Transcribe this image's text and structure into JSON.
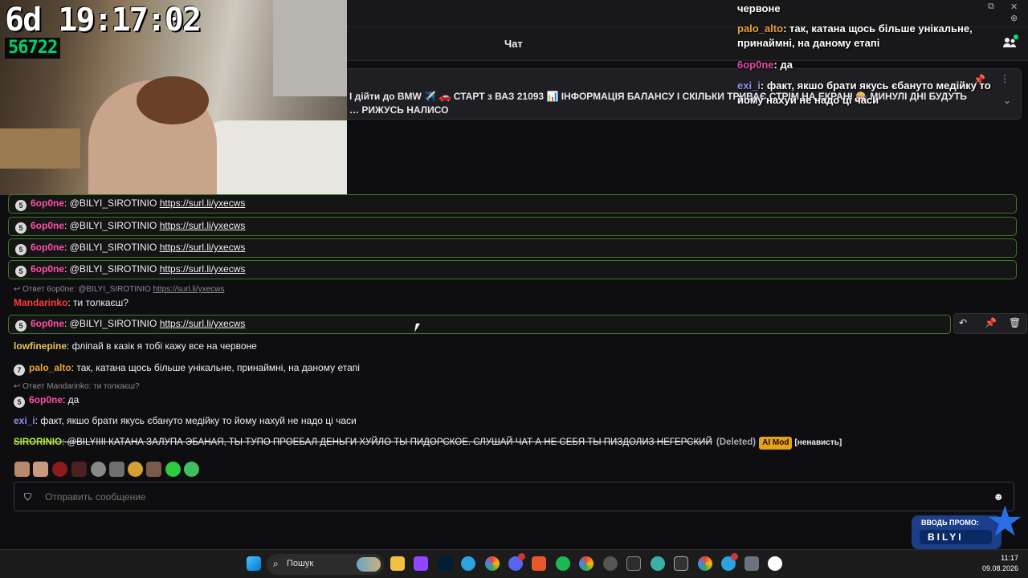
{
  "header": {
    "chat_title": "Чат"
  },
  "pinned": {
    "text": "І дійти до BMW ✈️ 🚗 СТАРТ з ВАЗ 21093 📊 ІНФОРМАЦІЯ БАЛАНСУ І СКІЛЬКИ ТРИВАЄ СТРІМ НА ЕКРАНІ 🎰 МИНУЛІ ДНІ БУДУТЬ … РИЖУСЬ НАЛИСО"
  },
  "stream": {
    "timer": "6d 19:17:02",
    "counter": "56722"
  },
  "overlay_chat": [
    {
      "user": "",
      "text": "червоне",
      "color": "#ffffff"
    },
    {
      "user": "palo_alto",
      "text": ": так, катана щось більше унікальне, принаймні, на даному етапі",
      "color": "#e8a23a"
    },
    {
      "user": "6op0ne",
      "text": ": да",
      "color": "#e54aa9"
    },
    {
      "user": "exi_i",
      "text": ": факт, якшо брати якусь єбануто медійку то йому нахуй не надо ці часи",
      "color": "#8f8ff0"
    }
  ],
  "messages": {
    "m1": {
      "badge": "5",
      "user": "6op0ne",
      "mention": ": @BILYI_SIROTINIO",
      "link": "https://surl.li/yxecws",
      "color": "#ff4fa7"
    },
    "m2": {
      "badge": "5",
      "user": "6op0ne",
      "mention": ": @BILYI_SIROTINIO",
      "link": "https://surl.li/yxecws",
      "color": "#ff4fa7"
    },
    "m3": {
      "badge": "5",
      "user": "6op0ne",
      "mention": ": @BILYI_SIROTINIO",
      "link": "https://surl.li/yxecws",
      "color": "#ff4fa7"
    },
    "m4": {
      "badge": "5",
      "user": "6op0ne",
      "mention": ": @BILYI_SIROTINIO",
      "link": "https://surl.li/yxecws",
      "color": "#ff4fa7"
    },
    "reply1": {
      "prefix": "↩ Ответ 6op0ne: @BILYI_SIROTINIO",
      "link": "https://surl.li/yxecws"
    },
    "m5": {
      "user": "Mandarinko",
      "text": ": ти толкаєш?",
      "color": "#ff3b3b"
    },
    "m6": {
      "badge": "5",
      "user": "6op0ne",
      "mention": ": @BILYI_SIROTINIO",
      "link": "https://surl.li/yxecws",
      "color": "#ff4fa7"
    },
    "m7": {
      "user": "lowfinepine",
      "text": ": фліпай в казік я тобі кажу все на червоне",
      "color": "#e6c45a"
    },
    "m8": {
      "badge": "7",
      "user": "palo_alto",
      "text": ": так, катана щось більше унікальне, принаймні, на даному етапі",
      "color": "#e8a23a"
    },
    "reply2": {
      "prefix": "↩ Ответ Mandarinko: ти толкаєш?"
    },
    "m9": {
      "badge": "5",
      "user": "6op0ne",
      "text": ": да",
      "color": "#ff4fa7"
    },
    "m10": {
      "user": "exi_i",
      "text": ": факт, якшо брати якусь єбануто медійку то йому нахуй не надо ці часи",
      "color": "#8f8ff0"
    },
    "m11": {
      "user": "SIRORINIO",
      "text": ": @BILYIIII КАТАНА ЗАЛУПА ЭБАНАЯ, ТЫ ТУПО ПРОЕБАЛ ДЕНЬГИ ХУЙЛО ТЫ ПИДОРСКОЕ. СЛУШАЙ ЧАТ А НЕ СЕБЯ ТЫ ПИЗДОЛИЗ НЕГЕРСКИЙ",
      "deleted": "(Deleted)",
      "ai_mod": "AI Mod",
      "reason": "[ненависть]",
      "color": "#b6e54a"
    }
  },
  "input": {
    "placeholder": "Отправить сообщение"
  },
  "promo": {
    "line1": "ВВОДЬ ПРОМО:",
    "line2": "BILYI"
  },
  "taskbar": {
    "search_label": "Пошук",
    "time": "11:17",
    "date": "09.08.2026"
  },
  "colors": {
    "accent_green": "#3c7a25",
    "ai_mod": "#e8a215"
  }
}
